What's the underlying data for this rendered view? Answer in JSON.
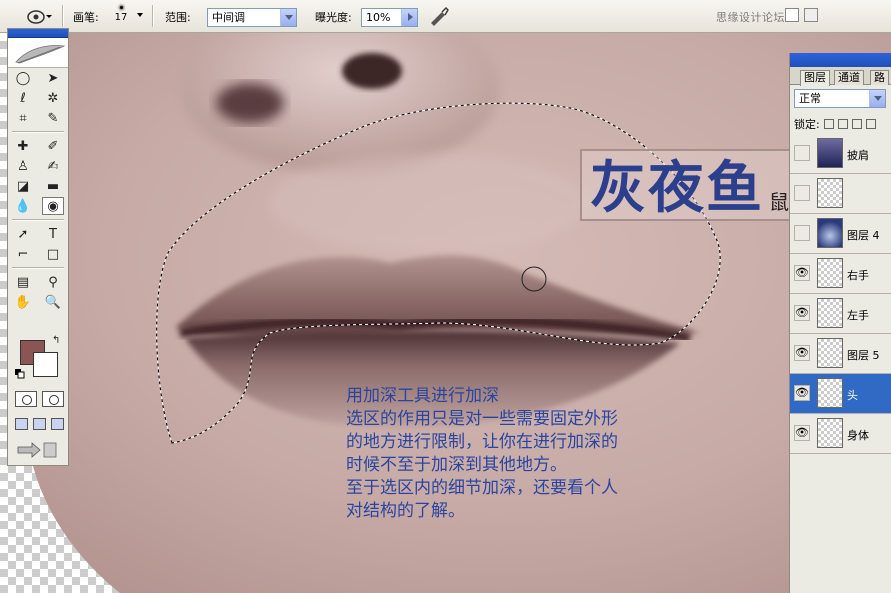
{
  "options_bar": {
    "brush_label": "画笔:",
    "brush_size": "17",
    "range_label": "范围:",
    "range_value": "中间调",
    "exposure_label": "曝光度:",
    "exposure_value": "10%",
    "watermark": "思缘设计论坛"
  },
  "canvas": {
    "logo_main": "灰夜鱼",
    "logo_sub": "鼠绘教程系列",
    "note_lines": [
      "用加深工具进行加深",
      "选区的作用只是对一些需要固定外形",
      "的地方进行限制，让你在进行加深的",
      "时候不至于加深到其他地方。",
      "至于选区内的细节加深，还要看个人",
      "对结构的了解。"
    ]
  },
  "tools": {
    "foreground_color": "#8b5556",
    "background_color": "#ffffff"
  },
  "layers_panel": {
    "tabs": [
      "图层",
      "通道",
      "路"
    ],
    "blend_mode": "正常",
    "lock_label": "锁定:",
    "layers": [
      {
        "name": "披肩",
        "visible": false,
        "thumb": "photo",
        "selected": false
      },
      {
        "name": "",
        "visible": false,
        "thumb": "transparent",
        "selected": false
      },
      {
        "name": "图层 4",
        "visible": false,
        "thumb": "photo2",
        "selected": false
      },
      {
        "name": "右手",
        "visible": true,
        "thumb": "transparent",
        "selected": false
      },
      {
        "name": "左手",
        "visible": true,
        "thumb": "transparent",
        "selected": false
      },
      {
        "name": "图层 5",
        "visible": true,
        "thumb": "transparent",
        "selected": false
      },
      {
        "name": "头",
        "visible": true,
        "thumb": "transparent",
        "selected": true
      },
      {
        "name": "身体",
        "visible": true,
        "thumb": "transparent",
        "selected": false
      }
    ]
  }
}
